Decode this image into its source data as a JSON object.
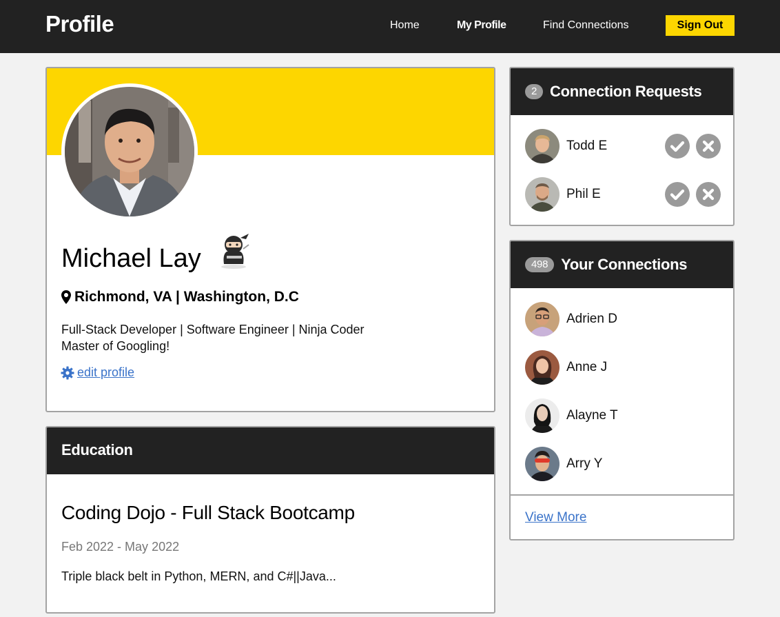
{
  "header": {
    "brand": "Profile",
    "nav": {
      "home": "Home",
      "my_profile": "My Profile",
      "find_connections": "Find Connections"
    },
    "sign_out": "Sign Out"
  },
  "profile": {
    "name": "Michael Lay",
    "location": "Richmond, VA | Washington, D.C",
    "bio_line1": "Full-Stack Developer | Software Engineer | Ninja Coder",
    "bio_line2": "Master of Googling!",
    "edit_label": " edit profile"
  },
  "education": {
    "header": "Education",
    "school": "Coding Dojo - Full Stack Bootcamp",
    "dates": "Feb 2022 - May 2022",
    "description": "Triple black belt in Python, MERN, and C#||Java..."
  },
  "connection_requests": {
    "count": "2",
    "title": "Connection Requests",
    "people": [
      {
        "name": "Todd E"
      },
      {
        "name": "Phil E"
      }
    ]
  },
  "connections": {
    "count": "498",
    "title": "Your Connections",
    "people": [
      {
        "name": "Adrien D"
      },
      {
        "name": "Anne J"
      },
      {
        "name": "Alayne T"
      },
      {
        "name": "Arry Y"
      }
    ],
    "view_more": "View More"
  },
  "colors": {
    "accent_yellow": "#fdd600",
    "dark": "#222222",
    "link": "#3a73c9",
    "icon_gray": "#9a9a9a"
  },
  "icons": [
    "map-pin-icon",
    "gear-icon",
    "check-icon",
    "close-icon",
    "ninja-sticker"
  ]
}
